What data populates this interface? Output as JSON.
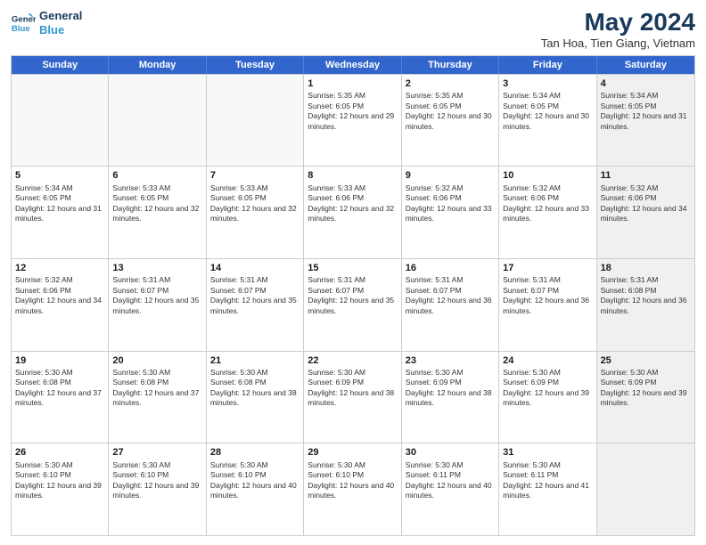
{
  "logo": {
    "line1": "General",
    "line2": "Blue"
  },
  "title": {
    "month_year": "May 2024",
    "location": "Tan Hoa, Tien Giang, Vietnam"
  },
  "days_of_week": [
    "Sunday",
    "Monday",
    "Tuesday",
    "Wednesday",
    "Thursday",
    "Friday",
    "Saturday"
  ],
  "rows": [
    [
      {
        "day": "",
        "empty": true
      },
      {
        "day": "",
        "empty": true
      },
      {
        "day": "",
        "empty": true
      },
      {
        "day": "1",
        "sunrise": "Sunrise: 5:35 AM",
        "sunset": "Sunset: 6:05 PM",
        "daylight": "Daylight: 12 hours and 29 minutes."
      },
      {
        "day": "2",
        "sunrise": "Sunrise: 5:35 AM",
        "sunset": "Sunset: 6:05 PM",
        "daylight": "Daylight: 12 hours and 30 minutes."
      },
      {
        "day": "3",
        "sunrise": "Sunrise: 5:34 AM",
        "sunset": "Sunset: 6:05 PM",
        "daylight": "Daylight: 12 hours and 30 minutes."
      },
      {
        "day": "4",
        "sunrise": "Sunrise: 5:34 AM",
        "sunset": "Sunset: 6:05 PM",
        "daylight": "Daylight: 12 hours and 31 minutes.",
        "shaded": true
      }
    ],
    [
      {
        "day": "5",
        "sunrise": "Sunrise: 5:34 AM",
        "sunset": "Sunset: 6:05 PM",
        "daylight": "Daylight: 12 hours and 31 minutes."
      },
      {
        "day": "6",
        "sunrise": "Sunrise: 5:33 AM",
        "sunset": "Sunset: 6:05 PM",
        "daylight": "Daylight: 12 hours and 32 minutes."
      },
      {
        "day": "7",
        "sunrise": "Sunrise: 5:33 AM",
        "sunset": "Sunset: 6:05 PM",
        "daylight": "Daylight: 12 hours and 32 minutes."
      },
      {
        "day": "8",
        "sunrise": "Sunrise: 5:33 AM",
        "sunset": "Sunset: 6:06 PM",
        "daylight": "Daylight: 12 hours and 32 minutes."
      },
      {
        "day": "9",
        "sunrise": "Sunrise: 5:32 AM",
        "sunset": "Sunset: 6:06 PM",
        "daylight": "Daylight: 12 hours and 33 minutes."
      },
      {
        "day": "10",
        "sunrise": "Sunrise: 5:32 AM",
        "sunset": "Sunset: 6:06 PM",
        "daylight": "Daylight: 12 hours and 33 minutes."
      },
      {
        "day": "11",
        "sunrise": "Sunrise: 5:32 AM",
        "sunset": "Sunset: 6:06 PM",
        "daylight": "Daylight: 12 hours and 34 minutes.",
        "shaded": true
      }
    ],
    [
      {
        "day": "12",
        "sunrise": "Sunrise: 5:32 AM",
        "sunset": "Sunset: 6:06 PM",
        "daylight": "Daylight: 12 hours and 34 minutes."
      },
      {
        "day": "13",
        "sunrise": "Sunrise: 5:31 AM",
        "sunset": "Sunset: 6:07 PM",
        "daylight": "Daylight: 12 hours and 35 minutes."
      },
      {
        "day": "14",
        "sunrise": "Sunrise: 5:31 AM",
        "sunset": "Sunset: 6:07 PM",
        "daylight": "Daylight: 12 hours and 35 minutes."
      },
      {
        "day": "15",
        "sunrise": "Sunrise: 5:31 AM",
        "sunset": "Sunset: 6:07 PM",
        "daylight": "Daylight: 12 hours and 35 minutes."
      },
      {
        "day": "16",
        "sunrise": "Sunrise: 5:31 AM",
        "sunset": "Sunset: 6:07 PM",
        "daylight": "Daylight: 12 hours and 36 minutes."
      },
      {
        "day": "17",
        "sunrise": "Sunrise: 5:31 AM",
        "sunset": "Sunset: 6:07 PM",
        "daylight": "Daylight: 12 hours and 36 minutes."
      },
      {
        "day": "18",
        "sunrise": "Sunrise: 5:31 AM",
        "sunset": "Sunset: 6:08 PM",
        "daylight": "Daylight: 12 hours and 36 minutes.",
        "shaded": true
      }
    ],
    [
      {
        "day": "19",
        "sunrise": "Sunrise: 5:30 AM",
        "sunset": "Sunset: 6:08 PM",
        "daylight": "Daylight: 12 hours and 37 minutes."
      },
      {
        "day": "20",
        "sunrise": "Sunrise: 5:30 AM",
        "sunset": "Sunset: 6:08 PM",
        "daylight": "Daylight: 12 hours and 37 minutes."
      },
      {
        "day": "21",
        "sunrise": "Sunrise: 5:30 AM",
        "sunset": "Sunset: 6:08 PM",
        "daylight": "Daylight: 12 hours and 38 minutes."
      },
      {
        "day": "22",
        "sunrise": "Sunrise: 5:30 AM",
        "sunset": "Sunset: 6:09 PM",
        "daylight": "Daylight: 12 hours and 38 minutes."
      },
      {
        "day": "23",
        "sunrise": "Sunrise: 5:30 AM",
        "sunset": "Sunset: 6:09 PM",
        "daylight": "Daylight: 12 hours and 38 minutes."
      },
      {
        "day": "24",
        "sunrise": "Sunrise: 5:30 AM",
        "sunset": "Sunset: 6:09 PM",
        "daylight": "Daylight: 12 hours and 39 minutes."
      },
      {
        "day": "25",
        "sunrise": "Sunrise: 5:30 AM",
        "sunset": "Sunset: 6:09 PM",
        "daylight": "Daylight: 12 hours and 39 minutes.",
        "shaded": true
      }
    ],
    [
      {
        "day": "26",
        "sunrise": "Sunrise: 5:30 AM",
        "sunset": "Sunset: 6:10 PM",
        "daylight": "Daylight: 12 hours and 39 minutes."
      },
      {
        "day": "27",
        "sunrise": "Sunrise: 5:30 AM",
        "sunset": "Sunset: 6:10 PM",
        "daylight": "Daylight: 12 hours and 39 minutes."
      },
      {
        "day": "28",
        "sunrise": "Sunrise: 5:30 AM",
        "sunset": "Sunset: 6:10 PM",
        "daylight": "Daylight: 12 hours and 40 minutes."
      },
      {
        "day": "29",
        "sunrise": "Sunrise: 5:30 AM",
        "sunset": "Sunset: 6:10 PM",
        "daylight": "Daylight: 12 hours and 40 minutes."
      },
      {
        "day": "30",
        "sunrise": "Sunrise: 5:30 AM",
        "sunset": "Sunset: 6:11 PM",
        "daylight": "Daylight: 12 hours and 40 minutes."
      },
      {
        "day": "31",
        "sunrise": "Sunrise: 5:30 AM",
        "sunset": "Sunset: 6:11 PM",
        "daylight": "Daylight: 12 hours and 41 minutes."
      },
      {
        "day": "",
        "empty": true,
        "shaded": true
      }
    ]
  ]
}
